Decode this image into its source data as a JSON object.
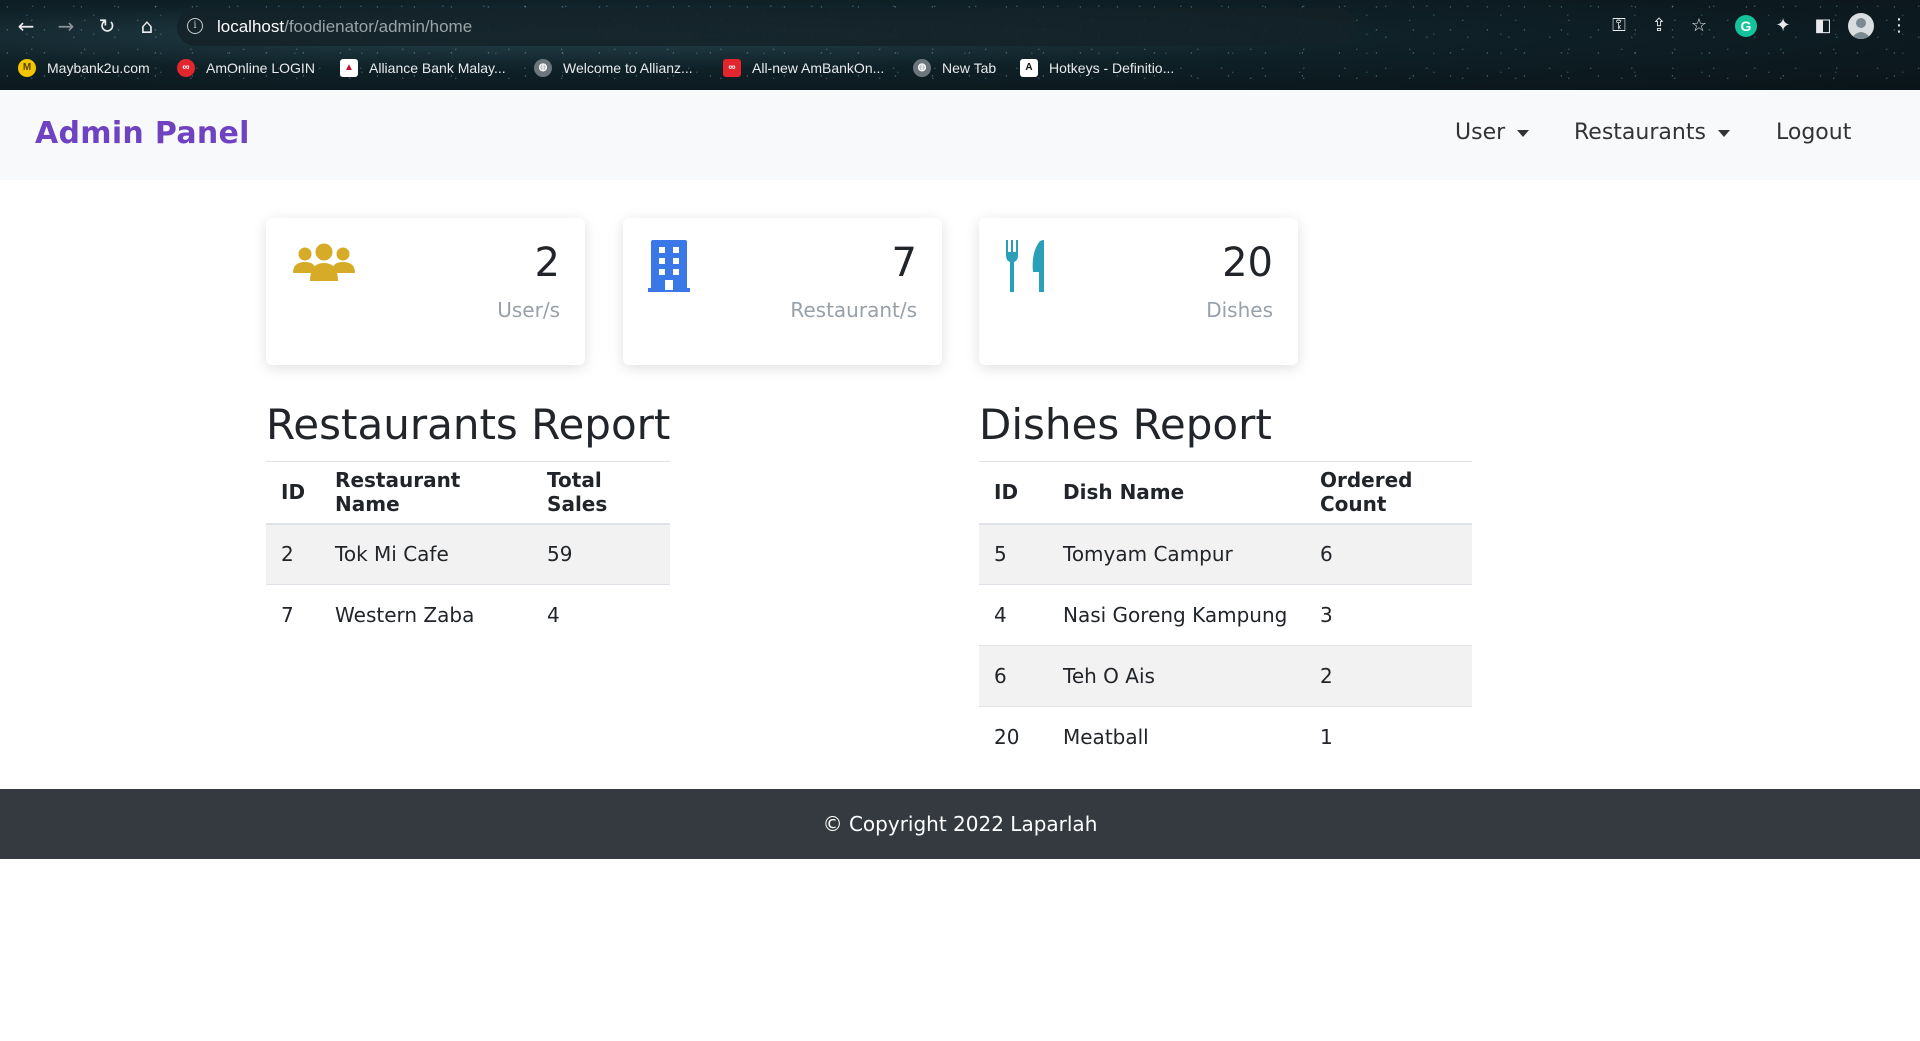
{
  "browser": {
    "url_host": "localhost",
    "url_path": "/foodienator/admin/home",
    "bookmarks": [
      {
        "label": "Maybank2u.com",
        "icon": "maybank-icon",
        "color": "#f2c500"
      },
      {
        "label": "AmOnline LOGIN",
        "icon": "ambank-icon",
        "color": "#e3262e"
      },
      {
        "label": "Alliance Bank Malay...",
        "icon": "alliance-bank-icon",
        "color": "#ffffff"
      },
      {
        "label": "Welcome to Allianz...",
        "icon": "globe-icon",
        "color": "#9aa3a8"
      },
      {
        "label": "All-new AmBankOn...",
        "icon": "ambank-icon",
        "color": "#e3262e"
      },
      {
        "label": "New Tab",
        "icon": "globe-icon",
        "color": "#9aa3a8"
      },
      {
        "label": "Hotkeys - Definitio...",
        "icon": "a-icon",
        "color": "#ffffff"
      }
    ]
  },
  "navbar": {
    "brand": "Admin Panel",
    "brand_color": "#6f42c1",
    "items": [
      {
        "label": "User",
        "dropdown": true
      },
      {
        "label": "Restaurants",
        "dropdown": true
      },
      {
        "label": "Logout",
        "dropdown": false
      }
    ]
  },
  "stats": [
    {
      "value": "2",
      "label": "User/s",
      "icon": "users-icon",
      "color": "#d6ab27"
    },
    {
      "value": "7",
      "label": "Restaurant/s",
      "icon": "building-icon",
      "color": "#3b78e7"
    },
    {
      "value": "20",
      "label": "Dishes",
      "icon": "utensils-icon",
      "color": "#2a9fb8"
    }
  ],
  "restaurants_report": {
    "title": "Restaurants Report",
    "columns": [
      "ID",
      "Restaurant Name",
      "Total Sales"
    ],
    "rows": [
      [
        "2",
        "Tok Mi Cafe",
        "59"
      ],
      [
        "7",
        "Western Zaba",
        "4"
      ]
    ]
  },
  "dishes_report": {
    "title": "Dishes Report",
    "columns": [
      "ID",
      "Dish Name",
      "Ordered Count"
    ],
    "rows": [
      [
        "5",
        "Tomyam Campur",
        "6"
      ],
      [
        "4",
        "Nasi Goreng Kampung",
        "3"
      ],
      [
        "6",
        "Teh O Ais",
        "2"
      ],
      [
        "20",
        "Meatball",
        "1"
      ]
    ]
  },
  "footer": {
    "text": "© Copyright 2022 Laparlah"
  }
}
